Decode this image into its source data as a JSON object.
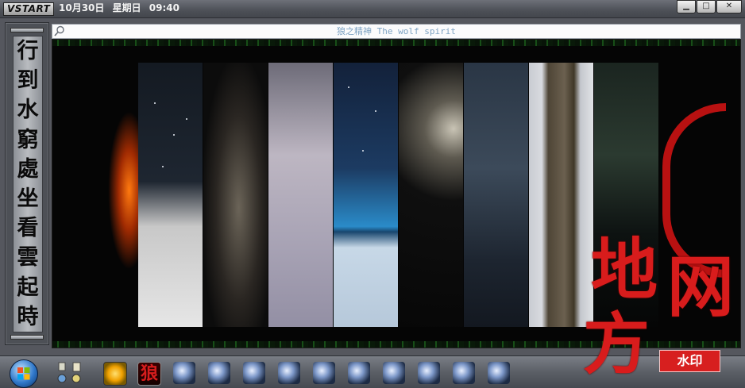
{
  "titlebar": {
    "logo": "VSTART",
    "date": "10月30日",
    "weekday": "星期日",
    "time": "09:40",
    "buttons": {
      "minimize": "▁",
      "maximize": "□",
      "close": "✕"
    }
  },
  "poem": {
    "chars": [
      "行",
      "到",
      "水",
      "窮",
      "處",
      "坐",
      "看",
      "雲",
      "起",
      "時"
    ]
  },
  "search": {
    "title": "狼之精神 The wolf spirit"
  },
  "taskbar": {
    "wolf_icon": "狼",
    "launch_icons": [
      "tool-icon",
      "tool-icon",
      "tool-icon",
      "tool-icon",
      "tool-icon",
      "tool-icon",
      "tool-icon",
      "tool-icon",
      "tool-icon",
      "tool-icon"
    ]
  },
  "watermark": {
    "chars": [
      "地",
      "网",
      "方"
    ],
    "tag": "水印",
    "color": "#d81c1c"
  }
}
